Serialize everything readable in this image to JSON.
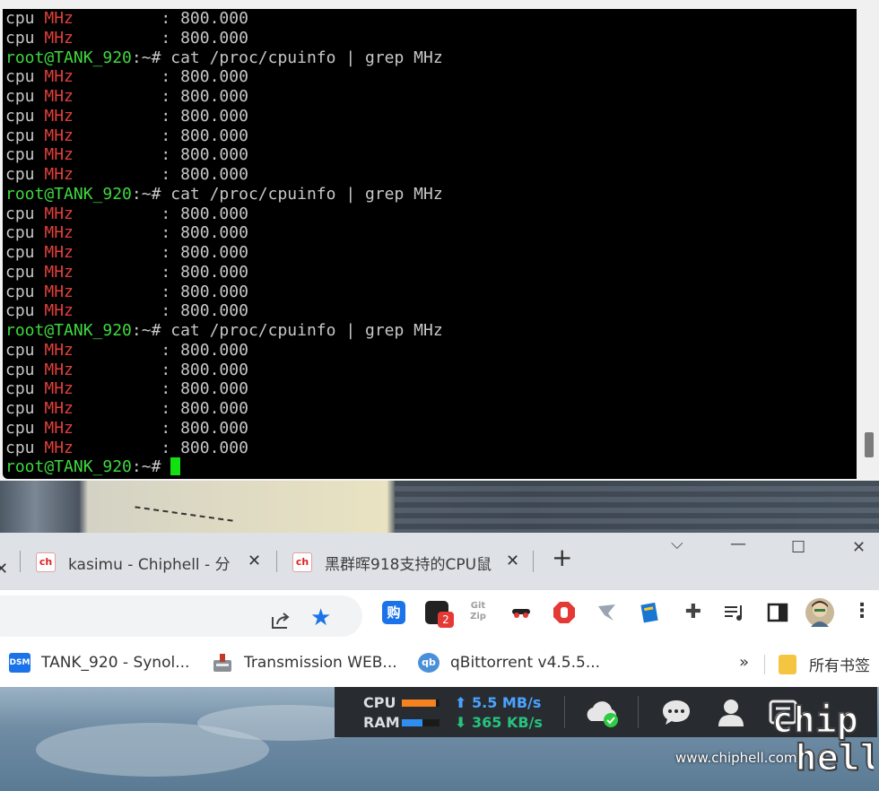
{
  "terminal": {
    "lines": [
      {
        "type": "out",
        "label": "cpu ",
        "red": "MHz",
        "rest": "         : 800.000"
      },
      {
        "type": "out",
        "label": "cpu ",
        "red": "MHz",
        "rest": "         : 800.000"
      },
      {
        "type": "cmd",
        "prompt": "root@TANK_920",
        "path": ":~",
        "cmd": "# cat /proc/cpuinfo | grep MHz"
      },
      {
        "type": "out",
        "label": "cpu ",
        "red": "MHz",
        "rest": "         : 800.000"
      },
      {
        "type": "out",
        "label": "cpu ",
        "red": "MHz",
        "rest": "         : 800.000"
      },
      {
        "type": "out",
        "label": "cpu ",
        "red": "MHz",
        "rest": "         : 800.000"
      },
      {
        "type": "out",
        "label": "cpu ",
        "red": "MHz",
        "rest": "         : 800.000"
      },
      {
        "type": "out",
        "label": "cpu ",
        "red": "MHz",
        "rest": "         : 800.000"
      },
      {
        "type": "out",
        "label": "cpu ",
        "red": "MHz",
        "rest": "         : 800.000"
      },
      {
        "type": "cmd",
        "prompt": "root@TANK_920",
        "path": ":~",
        "cmd": "# cat /proc/cpuinfo | grep MHz"
      },
      {
        "type": "out",
        "label": "cpu ",
        "red": "MHz",
        "rest": "         : 800.000"
      },
      {
        "type": "out",
        "label": "cpu ",
        "red": "MHz",
        "rest": "         : 800.000"
      },
      {
        "type": "out",
        "label": "cpu ",
        "red": "MHz",
        "rest": "         : 800.000"
      },
      {
        "type": "out",
        "label": "cpu ",
        "red": "MHz",
        "rest": "         : 800.000"
      },
      {
        "type": "out",
        "label": "cpu ",
        "red": "MHz",
        "rest": "         : 800.000"
      },
      {
        "type": "out",
        "label": "cpu ",
        "red": "MHz",
        "rest": "         : 800.000"
      },
      {
        "type": "cmd",
        "prompt": "root@TANK_920",
        "path": ":~",
        "cmd": "# cat /proc/cpuinfo | grep MHz"
      },
      {
        "type": "out",
        "label": "cpu ",
        "red": "MHz",
        "rest": "         : 800.000"
      },
      {
        "type": "out",
        "label": "cpu ",
        "red": "MHz",
        "rest": "         : 800.000"
      },
      {
        "type": "out",
        "label": "cpu ",
        "red": "MHz",
        "rest": "         : 800.000"
      },
      {
        "type": "out",
        "label": "cpu ",
        "red": "MHz",
        "rest": "         : 800.000"
      },
      {
        "type": "out",
        "label": "cpu ",
        "red": "MHz",
        "rest": "         : 800.000"
      },
      {
        "type": "out",
        "label": "cpu ",
        "red": "MHz",
        "rest": "         : 800.000"
      },
      {
        "type": "prompt",
        "prompt": "root@TANK_920",
        "path": ":~",
        "cmd": "# "
      }
    ]
  },
  "browser": {
    "tabs": [
      {
        "favicon": "chip-hell-icon",
        "title": "kasimu - Chiphell - 分",
        "close": "✕"
      },
      {
        "favicon": "chip-hell-icon",
        "title": "黑群晖918支持的CPU鼠",
        "close": "✕"
      }
    ],
    "partial_tab_close": "✕",
    "new_tab": "+",
    "window_controls": {
      "chevron": "⌵",
      "minimize": "—",
      "maximize": "☐",
      "close": "✕"
    },
    "extensions": [
      {
        "name": "gou-icon",
        "label": "购"
      },
      {
        "name": "notification-icon",
        "badge": "2"
      },
      {
        "name": "gitzip-icon",
        "label": "Git Zip"
      },
      {
        "name": "incognito-icon"
      },
      {
        "name": "stop-hand-icon"
      },
      {
        "name": "bird-icon"
      },
      {
        "name": "book-icon"
      },
      {
        "name": "puzzle-icon"
      },
      {
        "name": "media-queue-icon"
      },
      {
        "name": "sidepanel-icon"
      },
      {
        "name": "avatar"
      },
      {
        "name": "kebab-menu-icon"
      }
    ],
    "bookmarks": [
      {
        "icon": "DSM",
        "title": "TANK_920 - Synol..."
      },
      {
        "icon": "transmission-icon",
        "title": "Transmission WEB..."
      },
      {
        "icon": "qb",
        "title": "qBittorrent v4.5.5..."
      }
    ],
    "bookmarks_more": "»",
    "all_bookmarks": "所有书签"
  },
  "monitor": {
    "cpu_label": "CPU",
    "ram_label": "RAM",
    "cpu_level": 0.9,
    "ram_level": 0.55,
    "upload": "5.5 MB/s",
    "download": "365 KB/s",
    "colors": {
      "cpu": "#f5821f",
      "ram": "#2f8ff0",
      "upload": "#4aa3ff",
      "download": "#27c27e"
    }
  },
  "watermark": {
    "url": "www.chiphell.com",
    "logo": "chip hell"
  }
}
